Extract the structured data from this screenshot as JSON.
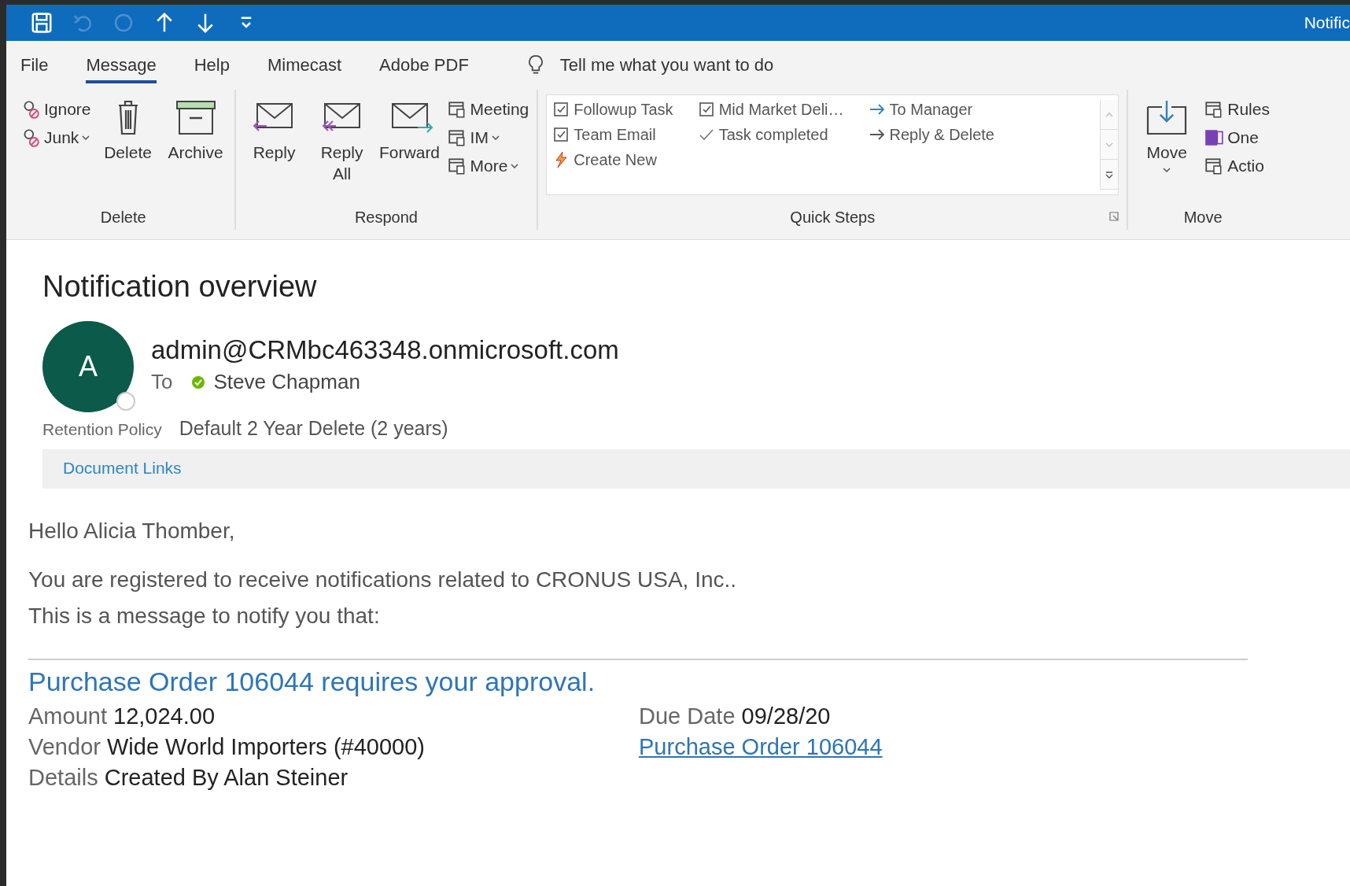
{
  "title_bar": {
    "title": "Notific",
    "quick_access": [
      {
        "disabled": false
      },
      {
        "disabled": true
      },
      {
        "disabled": true
      },
      {
        "disabled": false
      },
      {
        "disabled": false
      },
      {
        "disabled": false
      }
    ]
  },
  "menu_tabs": [
    {
      "label": "File",
      "selected": false
    },
    {
      "label": "Message",
      "selected": true
    },
    {
      "label": "Help",
      "selected": false
    },
    {
      "label": "Mimecast",
      "selected": false
    },
    {
      "label": "Adobe PDF",
      "selected": false
    }
  ],
  "tell_me": {
    "placeholder": "Tell me what you want to do"
  },
  "ribbon": {
    "groups": [
      {
        "label": "Delete",
        "items": [
          {
            "kind": "stack",
            "items": [
              {
                "label": "Ignore",
                "dropdown": false
              },
              {
                "label": "Junk",
                "dropdown": true
              }
            ]
          },
          {
            "kind": "large",
            "label": "Delete",
            "dropdown": false
          },
          {
            "kind": "large",
            "label": "Archive",
            "dropdown": false
          }
        ]
      },
      {
        "label": "Respond",
        "items": [
          {
            "kind": "large",
            "label": "Reply",
            "dropdown": false
          },
          {
            "kind": "large",
            "label": "Reply All",
            "dropdown": false
          },
          {
            "kind": "large",
            "label": "Forward",
            "dropdown": false
          },
          {
            "kind": "stack",
            "items": [
              {
                "label": "Meeting",
                "dropdown": false
              },
              {
                "label": "IM",
                "dropdown": true
              },
              {
                "label": "More",
                "dropdown": true
              }
            ]
          }
        ]
      },
      {
        "label": "Quick Steps",
        "items": [
          {
            "kind": "gallery",
            "columns": [
              [
                "Followup Task",
                "Team Email",
                "Create New"
              ],
              [
                "Mid Market Deli…",
                "Task completed"
              ],
              [
                "To Manager",
                "Reply & Delete"
              ]
            ]
          }
        ]
      },
      {
        "label": "Move",
        "items": [
          {
            "kind": "large",
            "label": "Move",
            "dropdown": true
          },
          {
            "kind": "stack",
            "items": [
              {
                "label": "Rules",
                "dropdown": false
              },
              {
                "label": "One",
                "dropdown": false
              },
              {
                "label": "Actio",
                "dropdown": false
              }
            ]
          }
        ]
      }
    ]
  },
  "message": {
    "subject": "Notification overview",
    "avatar_initial": "A",
    "sender": "admin@CRMbc463348.onmicrosoft.com",
    "to_label": "To",
    "recipient": {
      "name": "Steve Chapman",
      "online": true
    },
    "retention_label": "Retention Policy",
    "retention_value": "Default 2 Year Delete (2 years)",
    "tabs": [
      {
        "label": "Document Links",
        "selected": false
      }
    ]
  },
  "body": {
    "greeting": "Hello Alicia Thomber,",
    "lines": [
      "You are registered to receive notifications related to CRONUS USA, Inc..",
      "This is a message to notify you that:"
    ],
    "heading": "Purchase Order 106044 requires your approval.",
    "left_fields": [
      {
        "label": "Amount",
        "value": "12,024.00"
      },
      {
        "label": "Vendor",
        "value": "Wide World Importers (#40000)"
      },
      {
        "label": "Details",
        "value": "Created By Alan Steiner"
      }
    ],
    "right_fields": [
      {
        "label": "Due Date",
        "value": "09/28/20"
      },
      {
        "link": "Purchase Order 106044"
      }
    ]
  }
}
